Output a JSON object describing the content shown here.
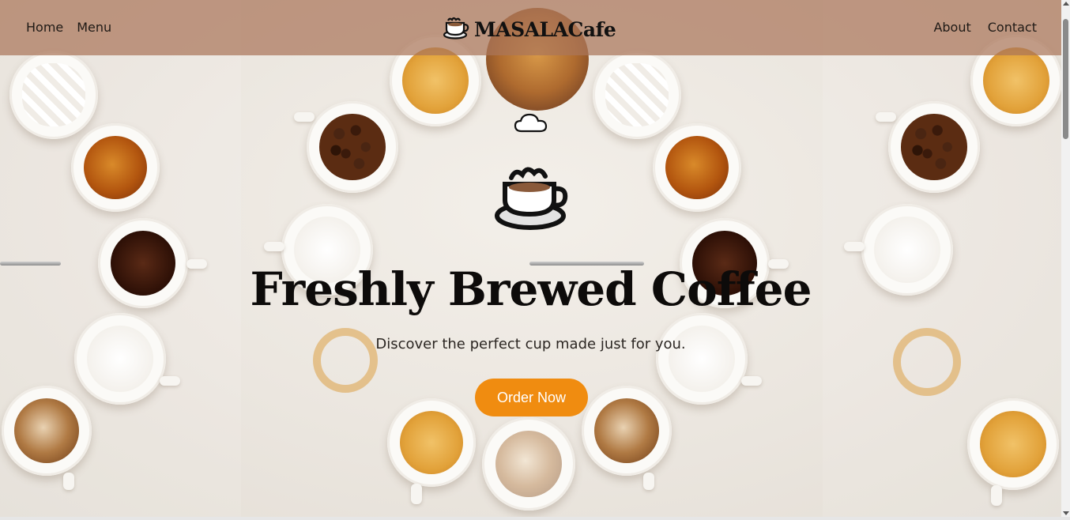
{
  "navbar": {
    "left_links": [
      "Home",
      "Menu"
    ],
    "brand": "MASALACafe",
    "right_links": [
      "About",
      "Contact"
    ]
  },
  "hero": {
    "headline": "Freshly Brewed Coffee",
    "subtitle": "Discover the perfect cup made just for you.",
    "cta_label": "Order Now"
  },
  "colors": {
    "navbar": "#aa765a",
    "cta": "#f08c10",
    "headline": "#0d0b0a"
  },
  "icons": [
    "coffee-cup-logo-icon",
    "cloud-icon"
  ]
}
